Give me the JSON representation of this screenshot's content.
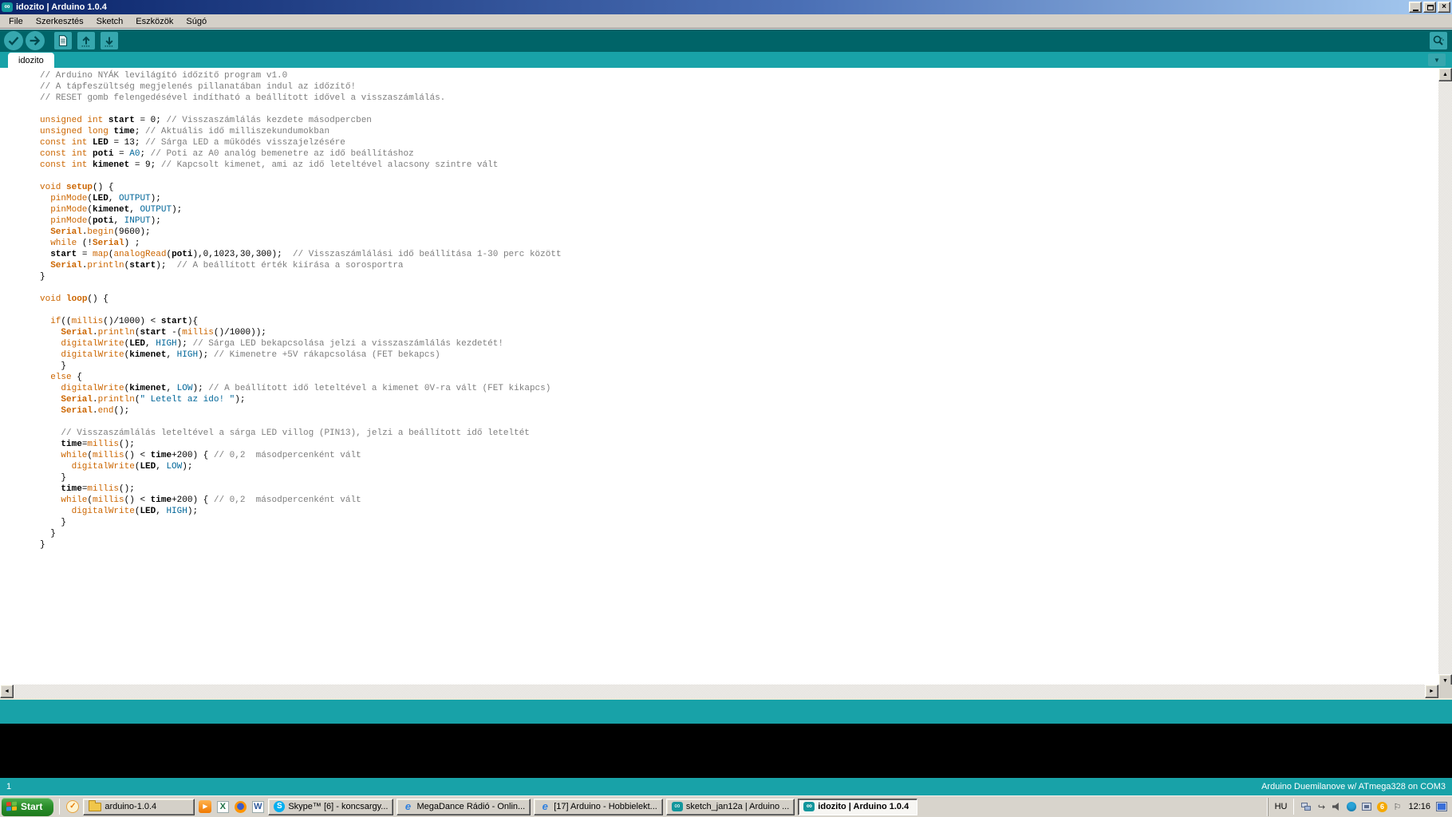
{
  "window": {
    "title": "idozito | Arduino 1.0.4",
    "app_icon": "∞"
  },
  "menu": [
    "File",
    "Szerkesztés",
    "Sketch",
    "Eszközök",
    "Súgó"
  ],
  "toolbar": [
    {
      "name": "verify-button",
      "icon": "check-icon"
    },
    {
      "name": "upload-button",
      "icon": "arrow-right-icon"
    },
    {
      "name": "new-sketch-button",
      "icon": "document-icon"
    },
    {
      "name": "open-sketch-button",
      "icon": "arrow-up-icon"
    },
    {
      "name": "save-sketch-button",
      "icon": "arrow-down-icon"
    }
  ],
  "serial_monitor": {
    "name": "serial-monitor-button",
    "icon": "magnifier-icon"
  },
  "tab": {
    "label": "idozito"
  },
  "editor": {
    "lines": [
      [
        [
          "c",
          "// Arduino NYÁK levilágító időzítő program v1.0"
        ]
      ],
      [
        [
          "c",
          "// A tápfeszültség megjelenés pillanatában indul az időzítő!"
        ]
      ],
      [
        [
          "c",
          "// RESET gomb felengedésével indítható a beállított idővel a visszaszámlálás."
        ]
      ],
      [],
      [
        [
          "k",
          "unsigned int"
        ],
        [
          "p",
          " "
        ],
        [
          "v",
          "start"
        ],
        [
          "p",
          " = 0; "
        ],
        [
          "c",
          "// Visszaszámlálás kezdete másodpercben"
        ]
      ],
      [
        [
          "k",
          "unsigned long"
        ],
        [
          "p",
          " "
        ],
        [
          "v",
          "time"
        ],
        [
          "p",
          "; "
        ],
        [
          "c",
          "// Aktuális idő milliszekundumokban"
        ]
      ],
      [
        [
          "k",
          "const int"
        ],
        [
          "p",
          " "
        ],
        [
          "v",
          "LED"
        ],
        [
          "p",
          " = 13; "
        ],
        [
          "c",
          "// Sárga LED a működés visszajelzésére"
        ]
      ],
      [
        [
          "k",
          "const int"
        ],
        [
          "p",
          " "
        ],
        [
          "v",
          "poti"
        ],
        [
          "p",
          " = "
        ],
        [
          "l",
          "A0"
        ],
        [
          "p",
          "; "
        ],
        [
          "c",
          "// Poti az A0 analóg bemenetre az idő beállításhoz"
        ]
      ],
      [
        [
          "k",
          "const int"
        ],
        [
          "p",
          " "
        ],
        [
          "v",
          "kimenet"
        ],
        [
          "p",
          " = 9; "
        ],
        [
          "c",
          "// Kapcsolt kimenet, ami az idő leteltével alacsony szintre vált"
        ]
      ],
      [],
      [
        [
          "k",
          "void "
        ],
        [
          "b",
          "setup"
        ],
        [
          "p",
          "() {"
        ]
      ],
      [
        [
          "p",
          "  "
        ],
        [
          "k",
          "pinMode"
        ],
        [
          "p",
          "("
        ],
        [
          "v",
          "LED"
        ],
        [
          "p",
          ", "
        ],
        [
          "l",
          "OUTPUT"
        ],
        [
          "p",
          ");"
        ]
      ],
      [
        [
          "p",
          "  "
        ],
        [
          "k",
          "pinMode"
        ],
        [
          "p",
          "("
        ],
        [
          "v",
          "kimenet"
        ],
        [
          "p",
          ", "
        ],
        [
          "l",
          "OUTPUT"
        ],
        [
          "p",
          ");"
        ]
      ],
      [
        [
          "p",
          "  "
        ],
        [
          "k",
          "pinMode"
        ],
        [
          "p",
          "("
        ],
        [
          "v",
          "poti"
        ],
        [
          "p",
          ", "
        ],
        [
          "l",
          "INPUT"
        ],
        [
          "p",
          ");"
        ]
      ],
      [
        [
          "p",
          "  "
        ],
        [
          "b",
          "Serial"
        ],
        [
          "p",
          "."
        ],
        [
          "k",
          "begin"
        ],
        [
          "p",
          "(9600);"
        ]
      ],
      [
        [
          "p",
          "  "
        ],
        [
          "k",
          "while"
        ],
        [
          "p",
          " (!"
        ],
        [
          "b",
          "Serial"
        ],
        [
          "p",
          ") ;"
        ]
      ],
      [
        [
          "p",
          "  "
        ],
        [
          "v",
          "start"
        ],
        [
          "p",
          " = "
        ],
        [
          "k",
          "map"
        ],
        [
          "p",
          "("
        ],
        [
          "k",
          "analogRead"
        ],
        [
          "p",
          "("
        ],
        [
          "v",
          "poti"
        ],
        [
          "p",
          "),0,1023,30,300);  "
        ],
        [
          "c",
          "// Visszaszámlálási idő beállítása 1-30 perc között"
        ]
      ],
      [
        [
          "p",
          "  "
        ],
        [
          "b",
          "Serial"
        ],
        [
          "p",
          "."
        ],
        [
          "k",
          "println"
        ],
        [
          "p",
          "("
        ],
        [
          "v",
          "start"
        ],
        [
          "p",
          ");  "
        ],
        [
          "c",
          "// A beállított érték kiírása a sorosportra"
        ]
      ],
      [
        [
          "p",
          "}"
        ]
      ],
      [],
      [
        [
          "k",
          "void "
        ],
        [
          "b",
          "loop"
        ],
        [
          "p",
          "() {"
        ]
      ],
      [],
      [
        [
          "p",
          "  "
        ],
        [
          "k",
          "if"
        ],
        [
          "p",
          "(("
        ],
        [
          "k",
          "millis"
        ],
        [
          "p",
          "()/1000) < "
        ],
        [
          "v",
          "start"
        ],
        [
          "p",
          "){"
        ]
      ],
      [
        [
          "p",
          "    "
        ],
        [
          "b",
          "Serial"
        ],
        [
          "p",
          "."
        ],
        [
          "k",
          "println"
        ],
        [
          "p",
          "("
        ],
        [
          "v",
          "start"
        ],
        [
          "p",
          " -("
        ],
        [
          "k",
          "millis"
        ],
        [
          "p",
          "()/1000));"
        ]
      ],
      [
        [
          "p",
          "    "
        ],
        [
          "k",
          "digitalWrite"
        ],
        [
          "p",
          "("
        ],
        [
          "v",
          "LED"
        ],
        [
          "p",
          ", "
        ],
        [
          "l",
          "HIGH"
        ],
        [
          "p",
          "); "
        ],
        [
          "c",
          "// Sárga LED bekapcsolása jelzi a visszaszámlálás kezdetét!"
        ]
      ],
      [
        [
          "p",
          "    "
        ],
        [
          "k",
          "digitalWrite"
        ],
        [
          "p",
          "("
        ],
        [
          "v",
          "kimenet"
        ],
        [
          "p",
          ", "
        ],
        [
          "l",
          "HIGH"
        ],
        [
          "p",
          "); "
        ],
        [
          "c",
          "// Kimenetre +5V rákapcsolása (FET bekapcs)"
        ]
      ],
      [
        [
          "p",
          "    }"
        ]
      ],
      [
        [
          "p",
          "  "
        ],
        [
          "k",
          "else"
        ],
        [
          "p",
          " {"
        ]
      ],
      [
        [
          "p",
          "    "
        ],
        [
          "k",
          "digitalWrite"
        ],
        [
          "p",
          "("
        ],
        [
          "v",
          "kimenet"
        ],
        [
          "p",
          ", "
        ],
        [
          "l",
          "LOW"
        ],
        [
          "p",
          "); "
        ],
        [
          "c",
          "// A beállított idő leteltével a kimenet 0V-ra vált (FET kikapcs)"
        ]
      ],
      [
        [
          "p",
          "    "
        ],
        [
          "b",
          "Serial"
        ],
        [
          "p",
          "."
        ],
        [
          "k",
          "println"
        ],
        [
          "p",
          "("
        ],
        [
          "l",
          "\" Letelt az ido! \""
        ],
        [
          "p",
          ");"
        ]
      ],
      [
        [
          "p",
          "    "
        ],
        [
          "b",
          "Serial"
        ],
        [
          "p",
          "."
        ],
        [
          "k",
          "end"
        ],
        [
          "p",
          "();"
        ]
      ],
      [],
      [
        [
          "p",
          "    "
        ],
        [
          "c",
          "// Visszaszámlálás leteltével a sárga LED villog (PIN13), jelzi a beállított idő leteltét"
        ]
      ],
      [
        [
          "p",
          "    "
        ],
        [
          "v",
          "time"
        ],
        [
          "p",
          "="
        ],
        [
          "k",
          "millis"
        ],
        [
          "p",
          "();"
        ]
      ],
      [
        [
          "p",
          "    "
        ],
        [
          "k",
          "while"
        ],
        [
          "p",
          "("
        ],
        [
          "k",
          "millis"
        ],
        [
          "p",
          "() < "
        ],
        [
          "v",
          "time"
        ],
        [
          "p",
          "+200) { "
        ],
        [
          "c",
          "// 0,2  másodpercenként vált"
        ]
      ],
      [
        [
          "p",
          "      "
        ],
        [
          "k",
          "digitalWrite"
        ],
        [
          "p",
          "("
        ],
        [
          "v",
          "LED"
        ],
        [
          "p",
          ", "
        ],
        [
          "l",
          "LOW"
        ],
        [
          "p",
          ");"
        ]
      ],
      [
        [
          "p",
          "    }"
        ]
      ],
      [
        [
          "p",
          "    "
        ],
        [
          "v",
          "time"
        ],
        [
          "p",
          "="
        ],
        [
          "k",
          "millis"
        ],
        [
          "p",
          "();"
        ]
      ],
      [
        [
          "p",
          "    "
        ],
        [
          "k",
          "while"
        ],
        [
          "p",
          "("
        ],
        [
          "k",
          "millis"
        ],
        [
          "p",
          "() < "
        ],
        [
          "v",
          "time"
        ],
        [
          "p",
          "+200) { "
        ],
        [
          "c",
          "// 0,2  másodpercenként vált"
        ]
      ],
      [
        [
          "p",
          "      "
        ],
        [
          "k",
          "digitalWrite"
        ],
        [
          "p",
          "("
        ],
        [
          "v",
          "LED"
        ],
        [
          "p",
          ", "
        ],
        [
          "l",
          "HIGH"
        ],
        [
          "p",
          ");"
        ]
      ],
      [
        [
          "p",
          "    }"
        ]
      ],
      [
        [
          "p",
          "  }"
        ]
      ],
      [
        [
          "p",
          "}"
        ]
      ]
    ]
  },
  "statusbar": {
    "line_indicator": "1",
    "board": "Arduino Duemilanove w/ ATmega328 on COM3"
  },
  "taskbar": {
    "start_label": "Start",
    "quick_icon": "orange-badge-icon",
    "items": [
      {
        "type": "button",
        "label": "arduino-1.0.4",
        "icon": "folder-icon",
        "active": false
      },
      {
        "type": "icon",
        "icon": "media-player-icon"
      },
      {
        "type": "icon",
        "icon": "excel-icon"
      },
      {
        "type": "icon",
        "icon": "firefox-icon"
      },
      {
        "type": "icon",
        "icon": "word-icon"
      },
      {
        "type": "button",
        "label": "Skype™ [6] - koncsargy...",
        "icon": "skype-icon",
        "active": false
      },
      {
        "type": "button",
        "label": "MegaDance Rádió - Onlin...",
        "icon": "ie-icon",
        "active": false
      },
      {
        "type": "button",
        "label": "[17] Arduino - Hobbielekt...",
        "icon": "ie-icon",
        "active": false
      },
      {
        "type": "button",
        "label": "sketch_jan12a | Arduino ...",
        "icon": "arduino-icon",
        "active": false
      },
      {
        "type": "button",
        "label": "idozito | Arduino 1.0.4",
        "icon": "arduino-icon",
        "active": true
      }
    ],
    "tray": {
      "language": "HU",
      "icons": [
        "network-computers-icon",
        "update-arrow-icon",
        "speaker-icon",
        "skype-tray-icon",
        "network-plug-icon",
        "java-update-icon",
        "flag-icon"
      ],
      "java_badge": "6",
      "clock": "12:16",
      "edge_icon": "display-icon"
    }
  },
  "colors": {
    "toolbar_bg": "#006468",
    "tab_strip_bg": "#18A2A8",
    "toolbar_button": "#36A7AE",
    "keyword": "#CC6600",
    "literal": "#006699",
    "comment": "#7E7E7E",
    "console_bg": "#000000",
    "titlebar_left": "#0A246A",
    "titlebar_right": "#A6CAF0"
  }
}
